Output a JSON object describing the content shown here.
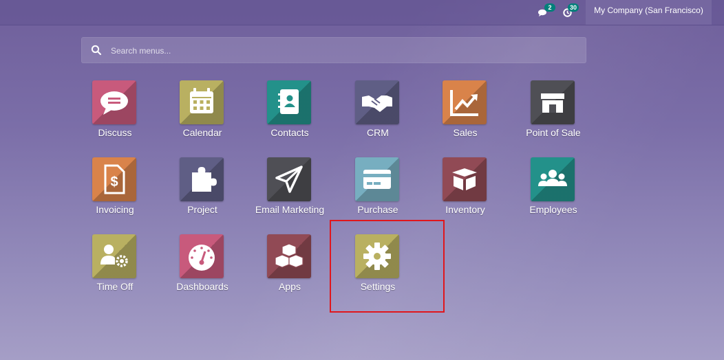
{
  "topbar": {
    "messages_badge": "2",
    "activities_badge": "30",
    "company": "My Company (San Francisco)"
  },
  "search": {
    "placeholder": "Search menus..."
  },
  "apps": [
    {
      "label": "Discuss",
      "icon": "chat-bubble-icon",
      "color": "#c85a7c"
    },
    {
      "label": "Calendar",
      "icon": "calendar-icon",
      "color": "#b9b061"
    },
    {
      "label": "Contacts",
      "icon": "address-book-icon",
      "color": "#23918a"
    },
    {
      "label": "CRM",
      "icon": "handshake-icon",
      "color": "#5f5e85"
    },
    {
      "label": "Sales",
      "icon": "trend-chart-icon",
      "color": "#d9834a"
    },
    {
      "label": "Point of Sale",
      "icon": "store-icon",
      "color": "#4f4f55"
    },
    {
      "label": "Invoicing",
      "icon": "invoice-dollar-icon",
      "color": "#d9834a"
    },
    {
      "label": "Project",
      "icon": "puzzle-icon",
      "color": "#5f5e85"
    },
    {
      "label": "Email Marketing",
      "icon": "paper-plane-icon",
      "color": "#4f4f55"
    },
    {
      "label": "Purchase",
      "icon": "credit-card-icon",
      "color": "#77aec0"
    },
    {
      "label": "Inventory",
      "icon": "box-icon",
      "color": "#914a55"
    },
    {
      "label": "Employees",
      "icon": "users-icon",
      "color": "#23918a"
    },
    {
      "label": "Time Off",
      "icon": "user-gear-icon",
      "color": "#b9b061"
    },
    {
      "label": "Dashboards",
      "icon": "gauge-icon",
      "color": "#c85a7c"
    },
    {
      "label": "Apps",
      "icon": "cubes-icon",
      "color": "#914a55"
    },
    {
      "label": "Settings",
      "icon": "gear-icon",
      "color": "#b9b061"
    }
  ]
}
